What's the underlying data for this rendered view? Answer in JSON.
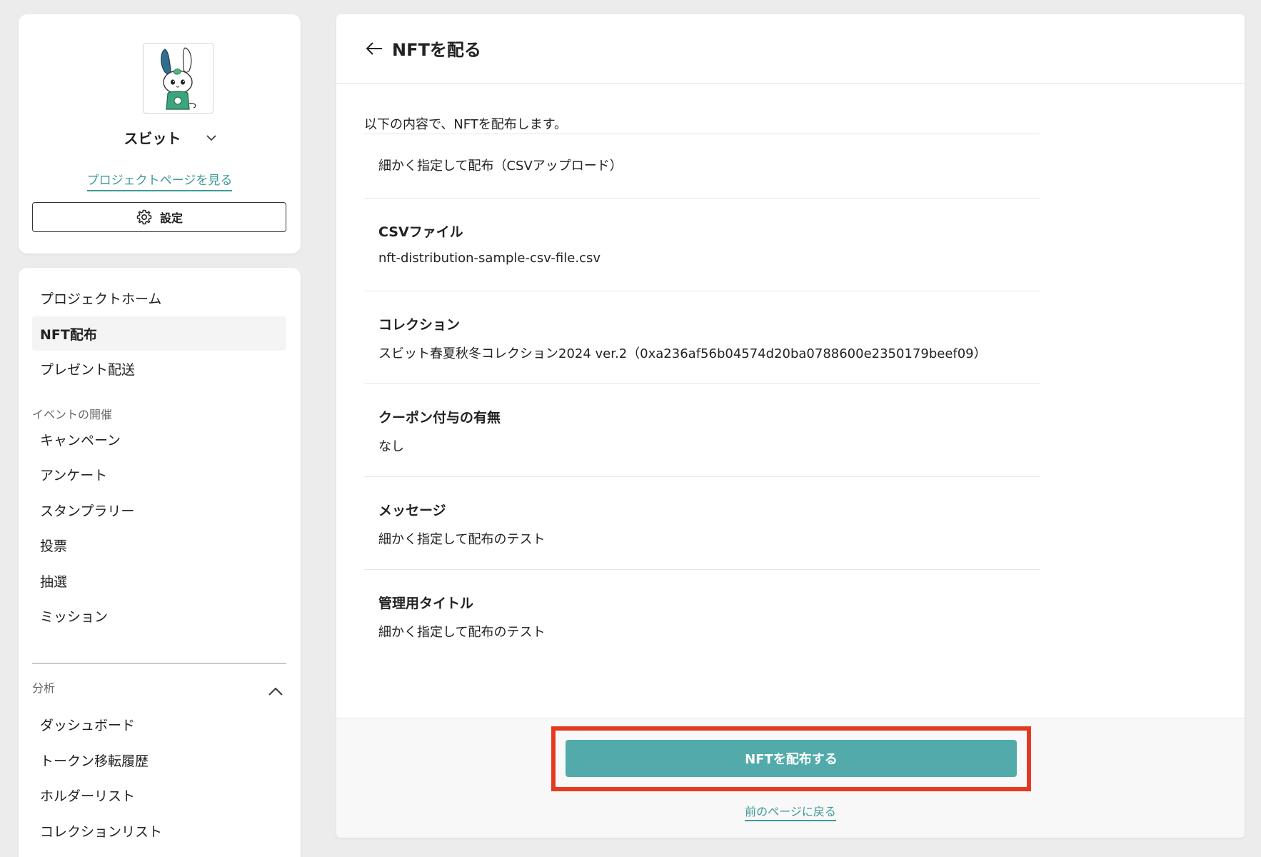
{
  "sidebar": {
    "project_name": "スビット",
    "project_page_link": "プロジェクトページを見る",
    "settings_label": "設定",
    "nav_primary": [
      {
        "label": "プロジェクトホーム",
        "active": false
      },
      {
        "label": "NFT配布",
        "active": true
      },
      {
        "label": "プレゼント配送",
        "active": false
      }
    ],
    "events_section": "イベントの開催",
    "nav_events": [
      {
        "label": "キャンペーン"
      },
      {
        "label": "アンケート"
      },
      {
        "label": "スタンプラリー"
      },
      {
        "label": "投票"
      },
      {
        "label": "抽選"
      },
      {
        "label": "ミッション"
      }
    ],
    "analysis_section": "分析",
    "nav_analysis": [
      {
        "label": "ダッシュボード"
      },
      {
        "label": "トークン移転履歴"
      },
      {
        "label": "ホルダーリスト"
      },
      {
        "label": "コレクションリスト"
      }
    ]
  },
  "main": {
    "title": "NFTを配る",
    "intro": "以下の内容で、NFTを配布します。",
    "method": "細かく指定して配布（CSVアップロード）",
    "details": [
      {
        "label": "CSVファイル",
        "value": "nft-distribution-sample-csv-file.csv"
      },
      {
        "label": "コレクション",
        "value": "スビット春夏秋冬コレクション2024 ver.2（0xa236af56b04574d20ba0788600e2350179beef09）"
      },
      {
        "label": "クーポン付与の有無",
        "value": "なし"
      },
      {
        "label": "メッセージ",
        "value": "細かく指定して配布のテスト"
      },
      {
        "label": "管理用タイトル",
        "value": "細かく指定して配布のテスト"
      }
    ],
    "submit_label": "NFTを配布する",
    "back_label": "前のページに戻る"
  },
  "colors": {
    "accent": "#52abaa",
    "link": "#3f9a98",
    "highlight": "#e33b22"
  }
}
